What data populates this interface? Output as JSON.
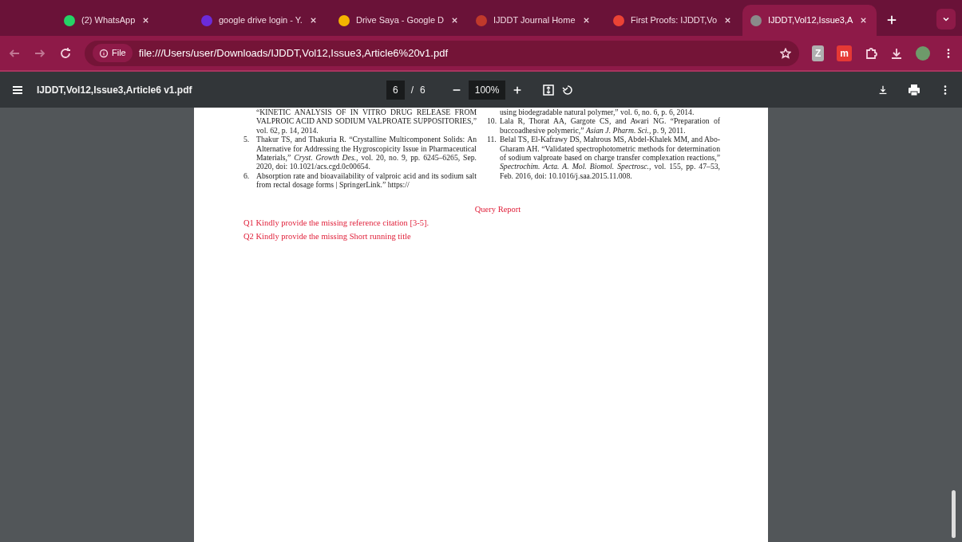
{
  "tabs": [
    {
      "title": "(2) WhatsApp",
      "selected": false,
      "color": "#25d366"
    },
    {
      "title": "google drive login - Y.",
      "selected": false,
      "color": "#6b2bd9"
    },
    {
      "title": "Drive Saya - Google D",
      "selected": false,
      "color": "#f4b400"
    },
    {
      "title": "IJDDT Journal Home",
      "selected": false,
      "color": "#c0392b"
    },
    {
      "title": "First Proofs: IJDDT,Vo",
      "selected": false,
      "color": "#ea4335"
    },
    {
      "title": "IJDDT,Vol12,Issue3,A",
      "selected": true,
      "color": "#8a8a8a"
    }
  ],
  "address_bar": {
    "scheme_chip": "File",
    "url": "file:///Users/user/Downloads/IJDDT,Vol12,Issue3,Article6%20v1.pdf"
  },
  "extensions": [
    {
      "label": "Z",
      "color": "#b0b0b0"
    },
    {
      "label": "m",
      "color": "#e53935"
    }
  ],
  "pdf_toolbar": {
    "title": "IJDDT,Vol12,Issue3,Article6 v1.pdf",
    "page": "6",
    "separator": "/",
    "page_count": "6",
    "zoom": "100%"
  },
  "references": {
    "left": [
      {
        "text": "“KINETIC ANALYSIS OF IN VITRO DRUG RELEASE FROM VALPROIC ACID AND SODIUM VALPROATE SUPPOSITORIES,” vol. 62, p. 14, 2014."
      },
      {
        "number": "5.",
        "text": "Thakur TS, and Thakuria R. “Crystalline Multicomponent Solids: An Alternative for Addressing the Hygroscopicity Issue in Pharmaceutical Materials,” *Cryst. Growth Des.*, vol. 20, no. 9, pp. 6245–6265, Sep. 2020, doi: 10.1021/acs.cgd.0c00654."
      },
      {
        "number": "6.",
        "text": "Absorption rate and bioavailability of valproic acid and its sodium salt from rectal dosage forms | SpringerLink.” https://"
      }
    ],
    "right": [
      {
        "text": "using biodegradable natural polymer,” vol. 6, no. 6, p. 6, 2014."
      },
      {
        "number": "10.",
        "text": "Lala R, Thorat AA, Gargote CS, and Awari NG. “Preparation of buccoadhesive polymeric,” *Asian J. Pharm. Sci.*, p. 9, 2011."
      },
      {
        "number": "11.",
        "text": "Belal TS, El-Kafrawy DS, Mahrous MS, Abdel-Khalek MM, and Abo-Gharam AH. “Validated spectrophotometric methods for determination of sodium valproate based on charge transfer complexation reactions,” *Spectrochim. Acta. A. Mol. Biomol. Spectrosc.*, vol. 155, pp. 47–53, Feb. 2016, doi: 10.1016/j.saa.2015.11.008."
      }
    ]
  },
  "query_report": {
    "heading": "Query Report",
    "queries": [
      "Q1 Kindly provide the missing reference citation [3-5].",
      "Q2 Kindly provide the missing Short running title"
    ]
  }
}
